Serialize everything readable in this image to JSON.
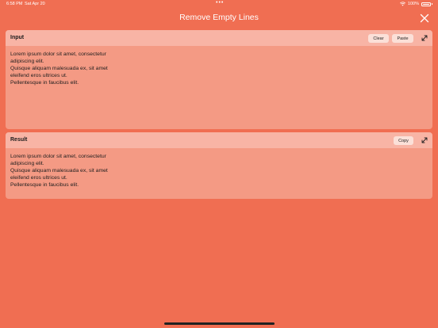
{
  "status_bar": {
    "time": "6:58 PM",
    "date": "Sat Apr 20",
    "dots": "•••",
    "battery_percent": "100%"
  },
  "window": {
    "title": "Remove Empty Lines"
  },
  "input_panel": {
    "title": "Input",
    "clear_label": "Clear",
    "paste_label": "Paste",
    "lines": [
      "Lorem ipsum dolor sit amet, consectetur",
      "adipiscing elit.",
      "Quisque aliquam malesuada ex, sit amet",
      "eleifend eros ultrices ut.",
      "Pellentesque in faucibus elit."
    ]
  },
  "result_panel": {
    "title": "Result",
    "copy_label": "Copy",
    "lines": [
      "Lorem ipsum dolor sit amet, consectetur",
      "adipiscing elit.",
      "Quisque aliquam malesuada ex, sit amet",
      "eleifend eros ultrices ut.",
      "Pellentesque in faucibus elit."
    ]
  },
  "colors": {
    "background": "#f06e52",
    "panel_body": "#f49a84",
    "panel_header": "#f8b4a5"
  }
}
